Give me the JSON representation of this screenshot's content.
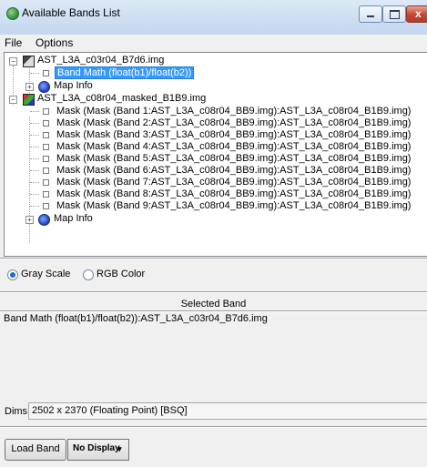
{
  "window": {
    "title": "Available Bands List",
    "icon": "app-globe-icon"
  },
  "menu": {
    "items": [
      "File",
      "Options"
    ]
  },
  "tree": {
    "files": [
      {
        "name": "AST_L3A_c03r04_B7d6.img",
        "bands": [
          "Band Math (float(b1)/float(b2))"
        ],
        "selected_band": 0,
        "extra": "Map Info"
      },
      {
        "name": "AST_L3A_c08r04_masked_B1B9.img",
        "bands": [
          "Mask (Mask (Band 1:AST_L3A_c08r04_BB9.img):AST_L3A_c08r04_B1B9.img)",
          "Mask (Mask (Band 2:AST_L3A_c08r04_BB9.img):AST_L3A_c08r04_B1B9.img)",
          "Mask (Mask (Band 3:AST_L3A_c08r04_BB9.img):AST_L3A_c08r04_B1B9.img)",
          "Mask (Mask (Band 4:AST_L3A_c08r04_BB9.img):AST_L3A_c08r04_B1B9.img)",
          "Mask (Mask (Band 5:AST_L3A_c08r04_BB9.img):AST_L3A_c08r04_B1B9.img)",
          "Mask (Mask (Band 6:AST_L3A_c08r04_BB9.img):AST_L3A_c08r04_B1B9.img)",
          "Mask (Mask (Band 7:AST_L3A_c08r04_BB9.img):AST_L3A_c08r04_B1B9.img)",
          "Mask (Mask (Band 8:AST_L3A_c08r04_BB9.img):AST_L3A_c08r04_B1B9.img)",
          "Mask (Mask (Band 9:AST_L3A_c08r04_BB9.img):AST_L3A_c08r04_B1B9.img)"
        ],
        "extra": "Map Info"
      }
    ]
  },
  "color_mode": {
    "options": [
      "Gray Scale",
      "RGB Color"
    ],
    "selected": "Gray Scale"
  },
  "selected_band": {
    "header": "Selected Band",
    "value": "Band Math (float(b1)/float(b2)):AST_L3A_c03r04_B7d6.img"
  },
  "dims": {
    "label": "Dims",
    "value": "2502 x 2370 (Floating Point) [BSQ]"
  },
  "buttons": {
    "load_band": "Load Band",
    "display": "No Display"
  },
  "colors": {
    "selection": "#3399ff",
    "title_bar": "#c3d7ee",
    "close_button": "#c74a36"
  }
}
